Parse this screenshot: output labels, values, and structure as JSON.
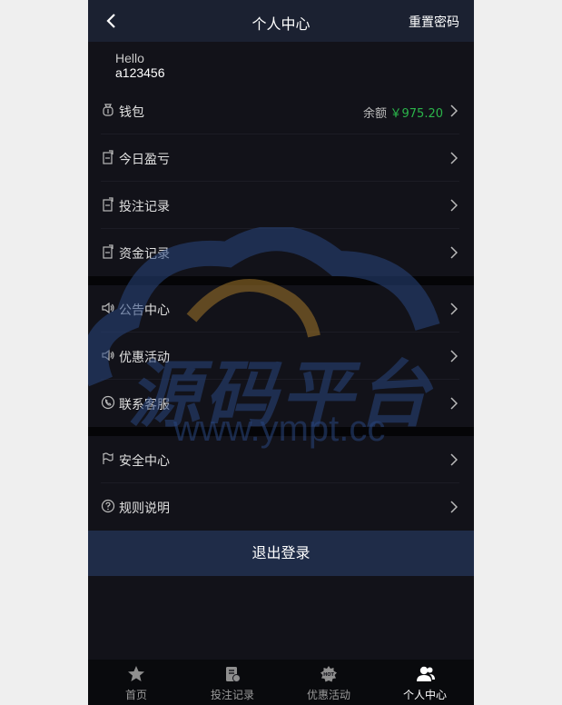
{
  "header": {
    "title": "个人中心",
    "reset_password": "重置密码"
  },
  "greeting": {
    "hello": "Hello",
    "username": "a123456"
  },
  "wallet": {
    "label": "钱包",
    "balance_label": "余额",
    "balance_value": "￥975.20"
  },
  "menu_group1": [
    {
      "label": "今日盈亏",
      "icon": "report-icon"
    },
    {
      "label": "投注记录",
      "icon": "report-icon"
    },
    {
      "label": "资金记录",
      "icon": "report-icon"
    }
  ],
  "menu_group2": [
    {
      "label": "公告中心",
      "icon": "speaker-icon"
    },
    {
      "label": "优惠活动",
      "icon": "speaker-icon"
    },
    {
      "label": "联系客服",
      "icon": "phone-icon"
    }
  ],
  "menu_group3": [
    {
      "label": "安全中心",
      "icon": "flag-icon"
    },
    {
      "label": "规则说明",
      "icon": "question-icon"
    }
  ],
  "logout": "退出登录",
  "watermark": {
    "text": "源码平台",
    "url": "www.ympt.cc"
  },
  "tabs": [
    {
      "label": "首页",
      "icon": "star-icon",
      "active": false
    },
    {
      "label": "投注记录",
      "icon": "bet-record-icon",
      "active": false
    },
    {
      "label": "优惠活动",
      "icon": "hot-icon",
      "active": false
    },
    {
      "label": "个人中心",
      "icon": "users-icon",
      "active": true
    }
  ],
  "colors": {
    "accent_green": "#2bb44a",
    "header_bg": "#1b2131",
    "logout_bg": "#1f2c48",
    "page_bg": "#121219"
  }
}
